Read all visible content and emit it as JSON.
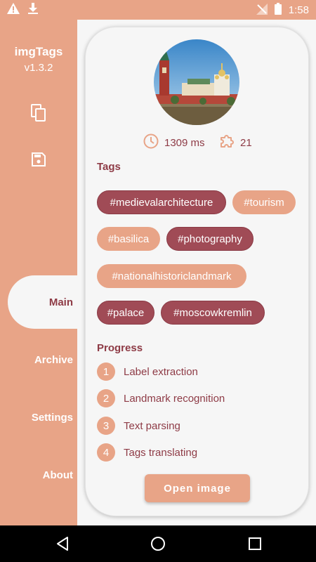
{
  "status_bar": {
    "time": "1:58",
    "icons": [
      "warning-icon",
      "download-icon",
      "signal-off-icon",
      "battery-icon"
    ]
  },
  "sidebar": {
    "app_name": "imgTags",
    "version": "v1.3.2",
    "actions": [
      "copy-icon",
      "save-icon"
    ],
    "nav": {
      "main": "Main",
      "archive": "Archive",
      "settings": "Settings",
      "about": "About"
    },
    "active": "Main"
  },
  "card": {
    "stats": {
      "time": "1309 ms",
      "tag_count": "21"
    },
    "tags_title": "Tags",
    "tags": {
      "t1": "#medievalarchitecture",
      "t2": "#tourism",
      "t3": "#basilica",
      "t4": "#photography",
      "t5": "#nationalhistoriclandmark",
      "t6": "#palace",
      "t7": "#moscowkremlin"
    },
    "progress_title": "Progress",
    "steps": {
      "s1": {
        "num": "1",
        "label": "Label extraction"
      },
      "s2": {
        "num": "2",
        "label": "Landmark recognition"
      },
      "s3": {
        "num": "3",
        "label": "Text parsing"
      },
      "s4": {
        "num": "4",
        "label": "Tags translating"
      }
    },
    "open_button": "Open image"
  },
  "colors": {
    "accent": "#e8a487",
    "dark_tag": "#a04b56",
    "text": "#8e3b46",
    "background": "#f6f6f6"
  },
  "system_nav": [
    "back-icon",
    "home-icon",
    "recents-icon"
  ]
}
